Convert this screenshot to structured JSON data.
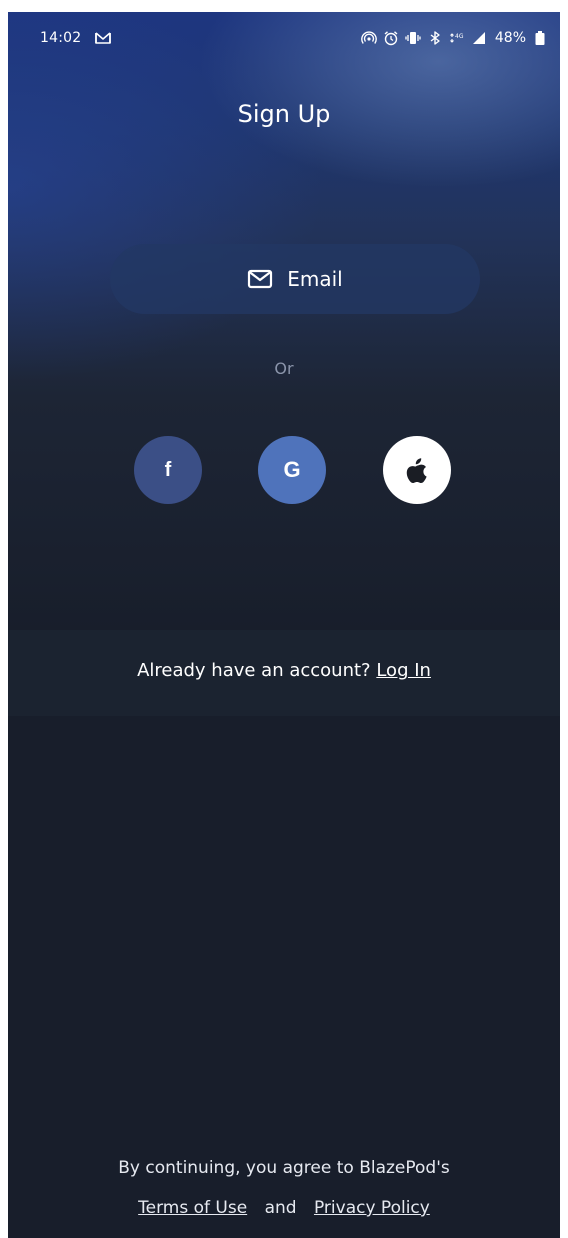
{
  "status_bar": {
    "time": "14:02",
    "battery_percent": "48%",
    "icons": [
      "gmail-icon",
      "hotspot-icon",
      "alarm-icon",
      "vibrate-icon",
      "bluetooth-icon",
      "data-4g-icon",
      "signal-icon",
      "battery-icon"
    ]
  },
  "header": {
    "title": "Sign Up"
  },
  "signup": {
    "email_label": "Email",
    "or_text": "Or",
    "social": [
      {
        "name": "facebook",
        "glyph": "f",
        "color": "#3b4f86"
      },
      {
        "name": "google",
        "glyph": "G",
        "color": "#4f73bb"
      },
      {
        "name": "apple",
        "color": "#ffffff"
      }
    ]
  },
  "account": {
    "prompt": "Already have an account?",
    "login_label": "Log In"
  },
  "footer": {
    "agree_text": "By continuing, you agree to BlazePod's",
    "terms_label": "Terms of Use",
    "and_text": "and",
    "privacy_label": "Privacy Policy"
  },
  "colors": {
    "background": "#181e2b",
    "gradient_top": "#1e3680",
    "facebook": "#3b4f86",
    "google": "#4f73bb",
    "apple": "#ffffff"
  }
}
